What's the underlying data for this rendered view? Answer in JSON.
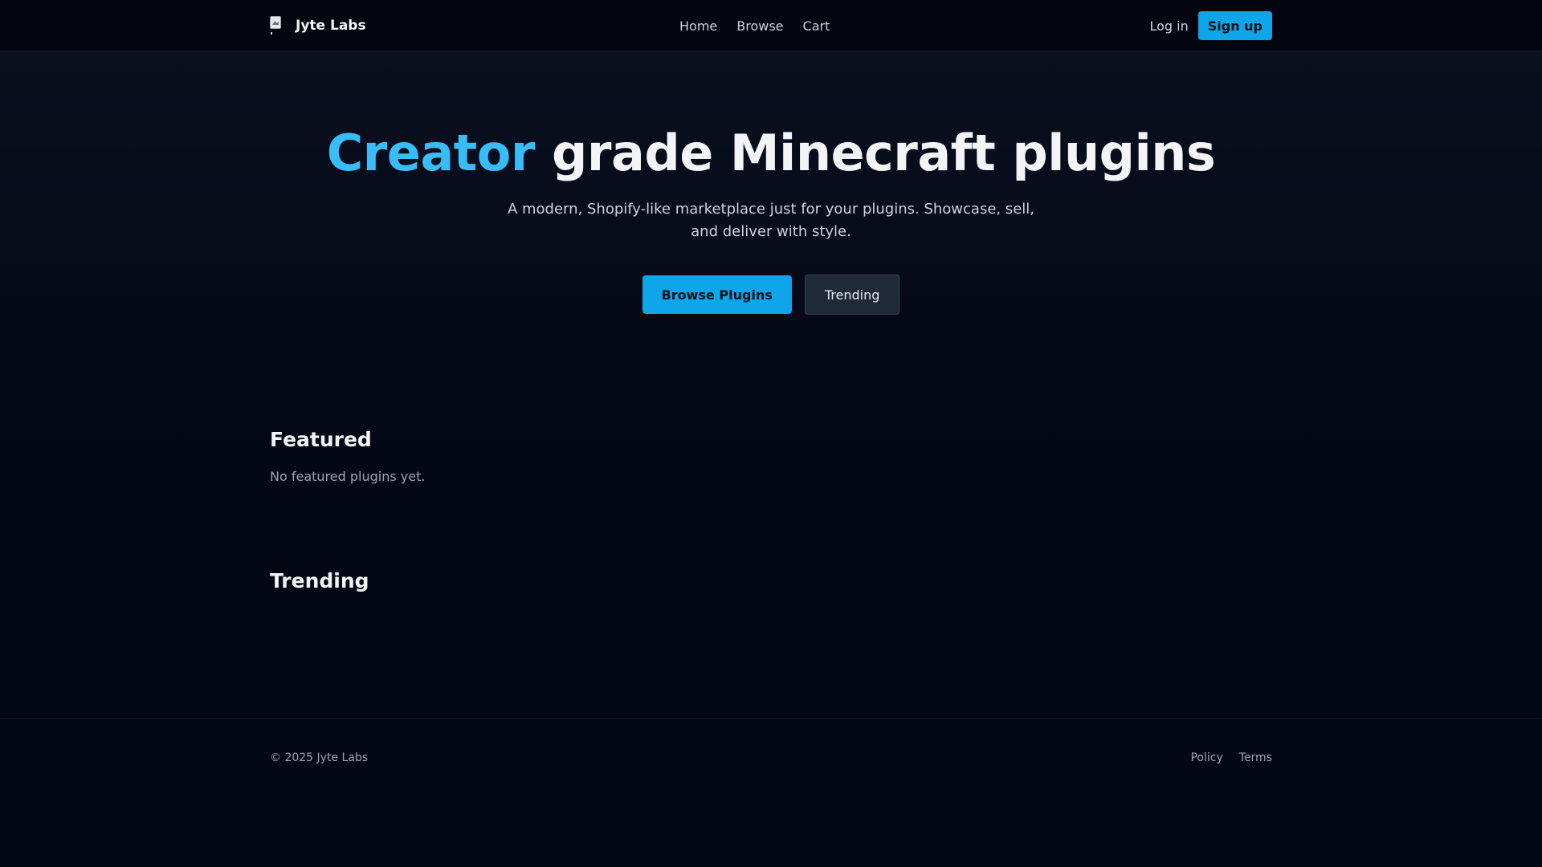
{
  "header": {
    "brand_name": "Jyte Labs",
    "nav": [
      {
        "label": "Home"
      },
      {
        "label": "Browse"
      },
      {
        "label": "Cart"
      }
    ],
    "login_label": "Log in",
    "signup_label": "Sign up"
  },
  "hero": {
    "title_accent": "Creator",
    "title_rest": " grade Minecraft plugins",
    "subtitle": "A modern, Shopify-like marketplace just for your plugins. Showcase, sell, and deliver with style.",
    "primary_label": "Browse Plugins",
    "secondary_label": "Trending"
  },
  "featured": {
    "title": "Featured",
    "empty_message": "No featured plugins yet."
  },
  "trending": {
    "title": "Trending"
  },
  "footer": {
    "copyright": "© 2025 Jyte Labs",
    "links": [
      {
        "label": "Policy"
      },
      {
        "label": "Terms"
      }
    ]
  },
  "colors": {
    "accent": "#38bdf8",
    "primary_button": "#0ea5e9",
    "background": "#050816"
  },
  "icons": {
    "brand_logo": "broken-image-icon"
  }
}
